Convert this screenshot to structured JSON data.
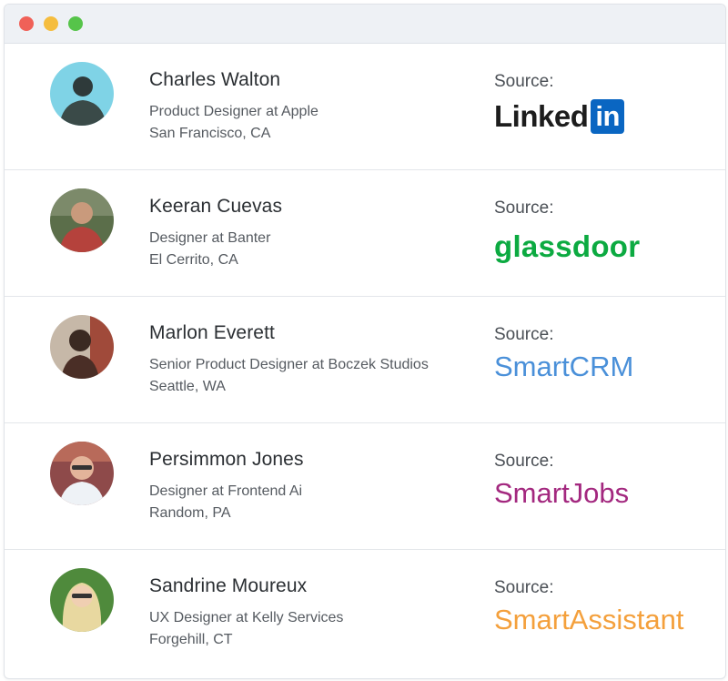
{
  "window": {
    "controls": [
      "close",
      "minimize",
      "maximize"
    ]
  },
  "source_label": "Source:",
  "people": [
    {
      "name": "Charles Walton",
      "title": "Product Designer at Apple",
      "location": "San Francisco, CA",
      "source": "LinkedIn",
      "source_text": "Linked",
      "source_badge": "in",
      "source_color": "#0a66c2"
    },
    {
      "name": "Keeran Cuevas",
      "title": "Designer at Banter",
      "location": "El Cerrito, CA",
      "source": "glassdoor",
      "source_text": "glassdoor",
      "source_color": "#0caa41"
    },
    {
      "name": "Marlon Everett",
      "title": "Senior Product Designer at Boczek Studios",
      "location": "Seattle, WA",
      "source": "SmartCRM",
      "source_text": "SmartCRM",
      "source_color": "#4a90d9"
    },
    {
      "name": "Persimmon Jones",
      "title": "Designer at Frontend Ai",
      "location": "Random, PA",
      "source": "SmartJobs",
      "source_text": "SmartJobs",
      "source_color": "#a3287f"
    },
    {
      "name": "Sandrine Moureux",
      "title": "UX Designer at Kelly Services",
      "location": "Forgehill, CT",
      "source": "SmartAssistant",
      "source_text": "SmartAssistant",
      "source_color": "#f4a03c"
    }
  ]
}
